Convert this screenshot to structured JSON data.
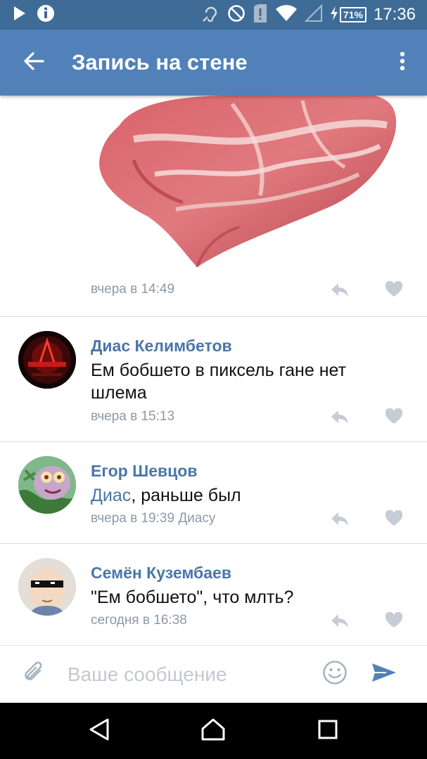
{
  "status_bar": {
    "battery_percent": "71%",
    "time": "17:36"
  },
  "app_bar": {
    "title": "Запись на стене"
  },
  "post": {
    "image_desc": "raw-meat-photo",
    "meta": "вчера в 14:49"
  },
  "comments": [
    {
      "author": "Диас Келимбетов",
      "text": "Ем бобшето в пиксель гане нет шлема",
      "meta": "вчера в 15:13"
    },
    {
      "author": "Егор Шевцов",
      "reply_to": "Диас",
      "text": ", раньше был",
      "meta": "вчера в 19:39 Диасу"
    },
    {
      "author": "Семён Кузембаев",
      "text": "\"Ем бобшето\", что млть?",
      "meta": "сегодня в 16:38"
    }
  ],
  "composer": {
    "placeholder": "Ваше сообщение"
  },
  "colors": {
    "status_bar": "#3e6c97",
    "app_bar": "#5181b8",
    "link": "#4a76a8",
    "meta": "#8e99a6",
    "action_icon": "#c5ccd4"
  },
  "icons": {
    "play": "play-icon",
    "info": "info-icon",
    "hearing_aid": "hearing-icon",
    "dnd": "do-not-disturb-icon",
    "sim": "sim-alert-icon",
    "wifi": "wifi-icon",
    "signal": "signal-icon",
    "charging": "charging-icon",
    "back": "arrow-left-icon",
    "menu": "more-vertical-icon",
    "reply": "reply-icon",
    "like": "heart-icon",
    "attach": "paperclip-icon",
    "emoji": "smiley-icon",
    "send": "send-icon"
  }
}
